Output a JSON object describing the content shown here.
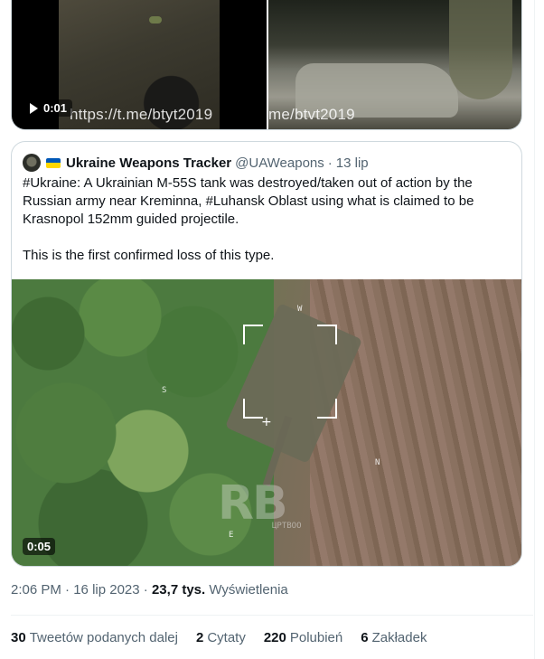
{
  "top_media": {
    "duration": "0:01",
    "watermark_left": "https://t.me/btyt2019",
    "watermark_right": "me/btvt2019"
  },
  "quote": {
    "author_name": "Ukraine Weapons Tracker",
    "handle": "@UAWeapons",
    "separator": "·",
    "date": "13 lip",
    "text_line1": "#Ukraine: A Ukrainian M-55S tank was destroyed/taken out of action by the Russian army near Kreminna, #Luhansk Oblast using what is claimed to be Krasnopol 152mm guided projectile.",
    "text_line2": "This is the first confirmed loss of this type.",
    "media": {
      "duration": "0:05",
      "compass_n_top": "W",
      "compass_s": "S",
      "compass_n": "N",
      "compass_e": "E",
      "logo": "RB",
      "logo_sub": "ЦРТВОО"
    },
    "flag_colors": [
      "#0057b7",
      "#ffd700"
    ]
  },
  "meta": {
    "time": "2:06 PM",
    "sep1": "·",
    "date": "16 lip 2023",
    "sep2": "·",
    "views": "23,7 tys.",
    "views_label": "Wyświetlenia"
  },
  "stats": [
    {
      "count": "30",
      "label": "Tweetów podanych dalej"
    },
    {
      "count": "2",
      "label": "Cytaty"
    },
    {
      "count": "220",
      "label": "Polubień"
    },
    {
      "count": "6",
      "label": "Zakładek"
    }
  ]
}
